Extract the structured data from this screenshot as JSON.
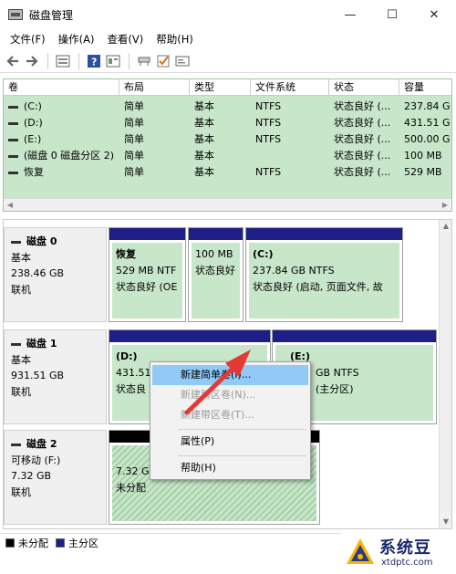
{
  "window": {
    "title": "磁盘管理",
    "minimize": "—",
    "maximize": "☐",
    "close": "✕"
  },
  "menu": [
    "文件(F)",
    "操作(A)",
    "查看(V)",
    "帮助(H)"
  ],
  "toolbar_icons": [
    "back-arrow-icon",
    "forward-arrow-icon",
    "disk-list-icon",
    "help-icon",
    "properties-icon",
    "connect-icon",
    "checkmark-icon",
    "volume-icon"
  ],
  "volume_list": {
    "columns": [
      "卷",
      "布局",
      "类型",
      "文件系统",
      "状态",
      "容量"
    ],
    "rows": [
      {
        "volume": "(C:)",
        "layout": "简单",
        "type": "基本",
        "fs": "NTFS",
        "status": "状态良好 (...",
        "capacity": "237.84 G"
      },
      {
        "volume": "(D:)",
        "layout": "简单",
        "type": "基本",
        "fs": "NTFS",
        "status": "状态良好 (...",
        "capacity": "431.51 G"
      },
      {
        "volume": "(E:)",
        "layout": "简单",
        "type": "基本",
        "fs": "NTFS",
        "status": "状态良好 (...",
        "capacity": "500.00 G"
      },
      {
        "volume": "(磁盘 0 磁盘分区 2)",
        "layout": "简单",
        "type": "基本",
        "fs": "",
        "status": "状态良好 (...",
        "capacity": "100 MB"
      },
      {
        "volume": "恢复",
        "layout": "简单",
        "type": "基本",
        "fs": "NTFS",
        "status": "状态良好 (...",
        "capacity": "529 MB"
      }
    ]
  },
  "disks": [
    {
      "name": "磁盘 0",
      "kind": "基本",
      "size": "238.46 GB",
      "state": "联机",
      "partitions": [
        {
          "label": "恢复",
          "line1": "529 MB NTF",
          "line2": "状态良好 (OE"
        },
        {
          "label": "",
          "line1": "100 MB",
          "line2": "状态良好"
        },
        {
          "label": "(C:)",
          "line1": "237.84 GB NTFS",
          "line2": "状态良好 (启动, 页面文件, 故"
        }
      ]
    },
    {
      "name": "磁盘 1",
      "kind": "基本",
      "size": "931.51 GB",
      "state": "联机",
      "partitions": [
        {
          "label": "(D:)",
          "line1": "431.51",
          "line2": "状态良"
        },
        {
          "label": "(E:)",
          "line1": "GB NTFS",
          "line2": "(主分区)"
        }
      ]
    },
    {
      "name": "磁盘 2",
      "kind": "可移动 (F:)",
      "size": "7.32 GB",
      "state": "联机",
      "partitions": [
        {
          "label": "",
          "line1": "7.32 GB",
          "line2": "未分配"
        }
      ]
    }
  ],
  "legend": [
    {
      "label": "未分配",
      "color": "#000000"
    },
    {
      "label": "主分区",
      "color": "#1d1f86"
    }
  ],
  "context_menu": [
    {
      "label": "新建简单卷(I)...",
      "enabled": true,
      "highlighted": true
    },
    {
      "label": "新建跨区卷(N)...",
      "enabled": false
    },
    {
      "label": "新建带区卷(T)...",
      "enabled": false
    },
    {
      "label": "属性(P)",
      "enabled": true
    },
    {
      "label": "帮助(H)",
      "enabled": true
    }
  ],
  "watermark": {
    "brand": "系统豆",
    "url": "xtdptc.com"
  },
  "colors": {
    "primary_partition": "#1d1f86",
    "volume_bg": "#c8e6c9",
    "menu_highlight": "#91c9f7",
    "arrow": "#e53935"
  }
}
